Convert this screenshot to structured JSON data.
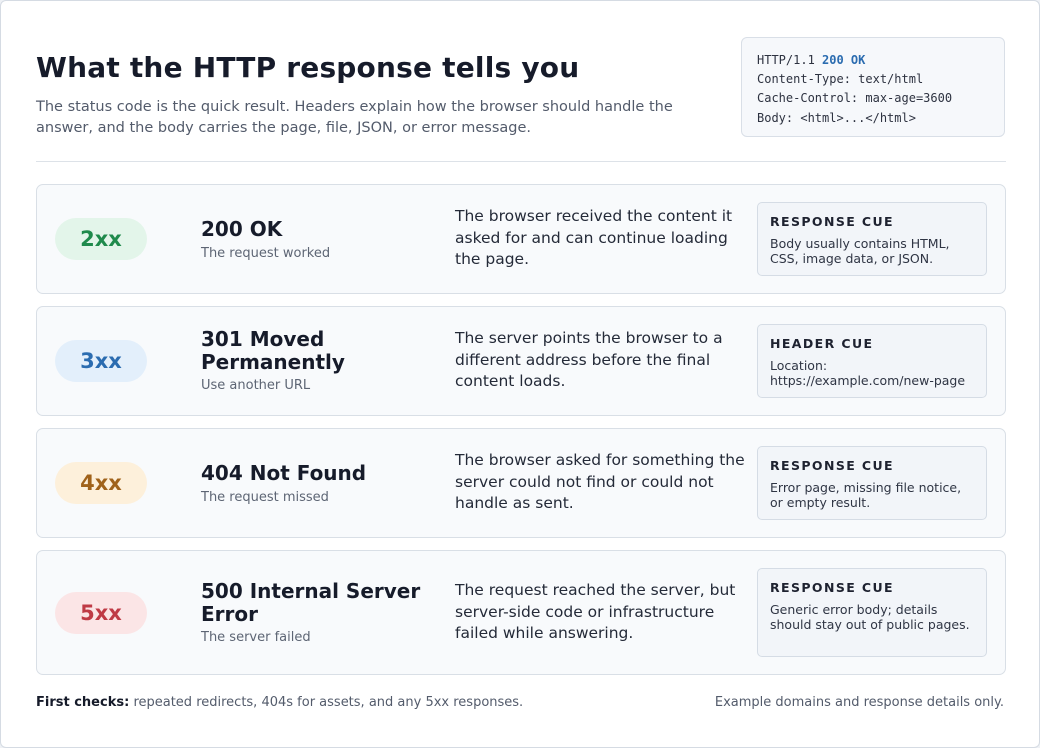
{
  "header": {
    "title": "What the HTTP response tells you",
    "subtitle": "The status code is the quick result. Headers explain how the browser should handle the answer, and the body carries the page, file, JSON, or error message."
  },
  "code_sample": {
    "protocol": "HTTP/1.1",
    "status": "200 OK",
    "line2": "Content-Type: text/html",
    "line3": "Cache-Control: max-age=3600",
    "line4": "Body: <html>...</html>"
  },
  "rows": [
    {
      "badge": "2xx",
      "badge_color": "#1f8a4c",
      "badge_bg": "#e3f5ea",
      "title": "200 OK",
      "subtitle": "The request worked",
      "description": "The browser received the content it asked for and can continue loading the page.",
      "cue_label": "RESPONSE CUE",
      "cue_text": "Body usually contains HTML, CSS, image data, or JSON."
    },
    {
      "badge": "3xx",
      "badge_color": "#2b6cb0",
      "badge_bg": "#e3effb",
      "title": "301 Moved Permanently",
      "subtitle": "Use another URL",
      "description": "The server points the browser to a different address before the final content loads.",
      "cue_label": "HEADER CUE",
      "cue_text": "Location: https://example.com/new-page"
    },
    {
      "badge": "4xx",
      "badge_color": "#a0621a",
      "badge_bg": "#fdf0db",
      "title": "404 Not Found",
      "subtitle": "The request missed",
      "description": "The browser asked for something the server could not find or could not handle as sent.",
      "cue_label": "RESPONSE CUE",
      "cue_text": "Error page, missing file notice, or empty result."
    },
    {
      "badge": "5xx",
      "badge_color": "#bf3a45",
      "badge_bg": "#fbe5e6",
      "title": "500 Internal Server Error",
      "subtitle": "The server failed",
      "description": "The request reached the server, but server-side code or infrastructure failed while answering.",
      "cue_label": "RESPONSE CUE",
      "cue_text": "Generic error body; details should stay out of public pages."
    }
  ],
  "footer": {
    "checks_label": "First checks:",
    "checks_text": "repeated redirects, 404s for assets, and any 5xx responses.",
    "note": "Example domains and response details only."
  }
}
